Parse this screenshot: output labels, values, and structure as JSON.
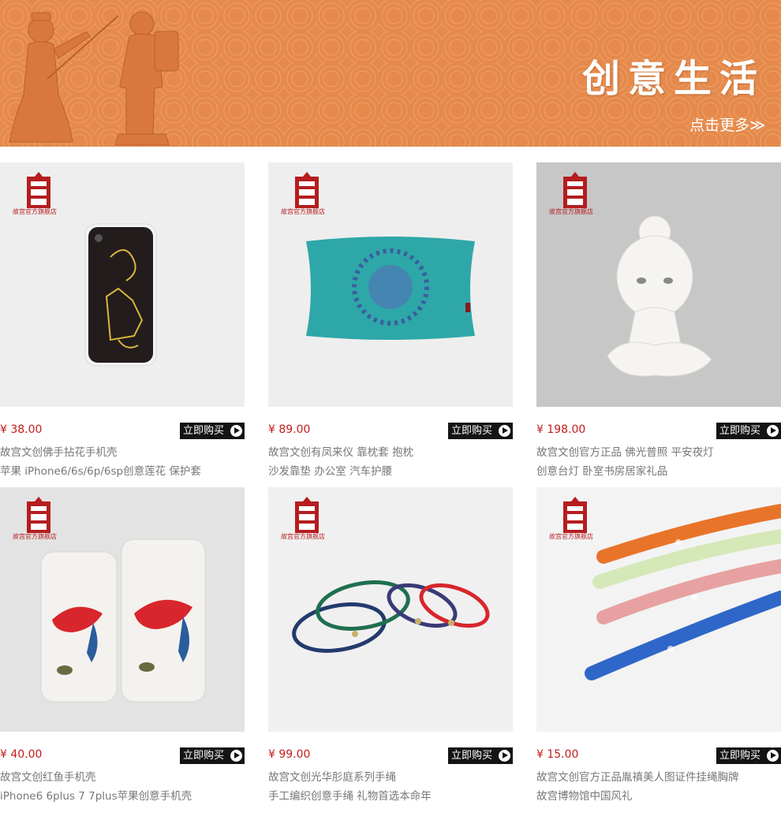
{
  "banner": {
    "title": "创意生活",
    "more_label": "点击更多≫",
    "color": "#e58a4c"
  },
  "logo_text": "故宫官方旗舰店",
  "buy_label": "立即购买",
  "products": [
    {
      "price": "¥ 38.00",
      "line1": "故宫文创佛手拈花手机壳",
      "line2": "苹果 iPhone6/6s/6p/6sp创意莲花 保护套",
      "icon": "phone-case"
    },
    {
      "price": "¥ 89.00",
      "line1": "故宫文创有凤来仪 靠枕套 抱枕",
      "line2": "沙发靠垫 办公室 汽车护腰",
      "icon": "pillow"
    },
    {
      "price": "¥ 198.00",
      "line1": "故宫文创官方正品 佛光普照 平安夜灯",
      "line2": "创意台灯 卧室书房居家礼品",
      "icon": "buddha-lamp"
    },
    {
      "price": "¥ 40.00",
      "line1": "故宫文创红鱼手机壳",
      "line2": "iPhone6 6plus 7 7plus苹果创意手机壳",
      "icon": "fish-phone-case"
    },
    {
      "price": "¥ 99.00",
      "line1": "故宫文创光华肜庭系列手绳",
      "line2": "手工编织创意手绳 礼物首选本命年",
      "icon": "bracelets"
    },
    {
      "price": "¥ 15.00",
      "line1": "故宫文创官方正品胤禛美人图证件挂绳胸牌",
      "line2": "故宫博物馆中国风礼",
      "icon": "lanyards"
    }
  ],
  "colors": {
    "price": "#c41b1b",
    "button": "#141414",
    "logo": "#b51d20"
  }
}
